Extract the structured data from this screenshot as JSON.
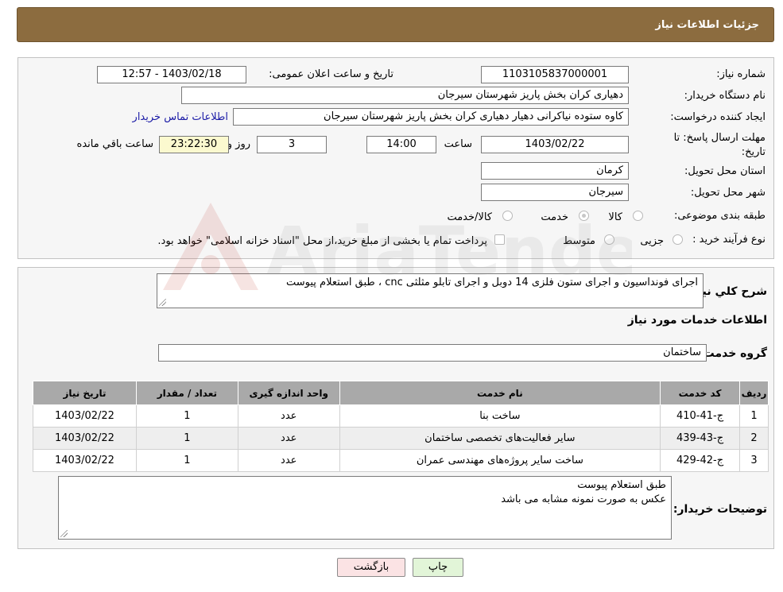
{
  "header": {
    "title": "جزئیات اطلاعات نیاز"
  },
  "info": {
    "need_number_label": "شماره نیاز:",
    "need_number": "1103105837000001",
    "announce_label": "تاریخ و ساعت اعلان عمومی:",
    "announce_value": "1403/02/18 - 12:57",
    "buyer_org_label": "نام دستگاه خریدار:",
    "buyer_org": "دهیاری کران بخش پاریز شهرستان سیرجان",
    "creator_label": "ایجاد کننده درخواست:",
    "creator": "کاوه ستوده نیاکرانی دهیار دهیاری کران بخش پاریز شهرستان سیرجان",
    "contact_link": "اطلاعات تماس خریدار",
    "deadline_label_1": "مهلت ارسال پاسخ: تا",
    "deadline_label_2": "تاریخ:",
    "deadline_date": "1403/02/22",
    "time_label": "ساعت",
    "deadline_time": "14:00",
    "days_value": "3",
    "days_label": "روز و",
    "remaining_time": "23:22:30",
    "remaining_label": "ساعت باقي مانده",
    "province_label": "استان محل تحویل:",
    "province": "کرمان",
    "city_label": "شهر محل تحویل:",
    "city": "سیرجان",
    "category_label": "طبقه بندی موضوعی:",
    "category_options": [
      "کالا",
      "خدمت",
      "کالا/خدمت"
    ],
    "process_label": "نوع فرآیند خرید :",
    "process_options": [
      "جزیی",
      "متوسط"
    ],
    "payment_note": "پرداخت تمام یا بخشی از مبلغ خرید،از محل \"اسناد خزانه اسلامی\" خواهد بود."
  },
  "details": {
    "summary_label": "شرح کلي نیاز:",
    "summary": "اجرای فونداسیون و اجرای ستون فلزی 14 دوبل و اجرای تابلو مثلثی cnc ، طبق استعلام پیوست",
    "services_heading": "اطلاعات خدمات مورد نیاز",
    "service_group_label": "گروه خدمت:",
    "service_group": "ساختمان",
    "table": {
      "headers": [
        "ردیف",
        "کد خدمت",
        "نام خدمت",
        "واحد اندازه گیری",
        "تعداد / مقدار",
        "تاریخ نیاز"
      ],
      "rows": [
        [
          "1",
          "ج-41-410",
          "ساخت بنا",
          "عدد",
          "1",
          "1403/02/22"
        ],
        [
          "2",
          "ج-43-439",
          "سایر فعالیت‌های تخصصی ساختمان",
          "عدد",
          "1",
          "1403/02/22"
        ],
        [
          "3",
          "ج-42-429",
          "ساخت سایر پروژه‌های مهندسی عمران",
          "عدد",
          "1",
          "1403/02/22"
        ]
      ]
    },
    "buyer_notes_label": "توضیحات خریدار:",
    "buyer_notes_line1": "طبق استعلام پیوست",
    "buyer_notes_line2": "عکس به صورت نمونه مشابه می باشد"
  },
  "buttons": {
    "print": "چاپ",
    "back": "بازگشت"
  },
  "watermark": {
    "text": "AriaTender.neT"
  },
  "colors": {
    "header_bg": "#8c6c3f",
    "back_button_bg": "#fbe3e4",
    "print_button_bg": "#e2f5d8",
    "link": "#1a1aa6"
  }
}
